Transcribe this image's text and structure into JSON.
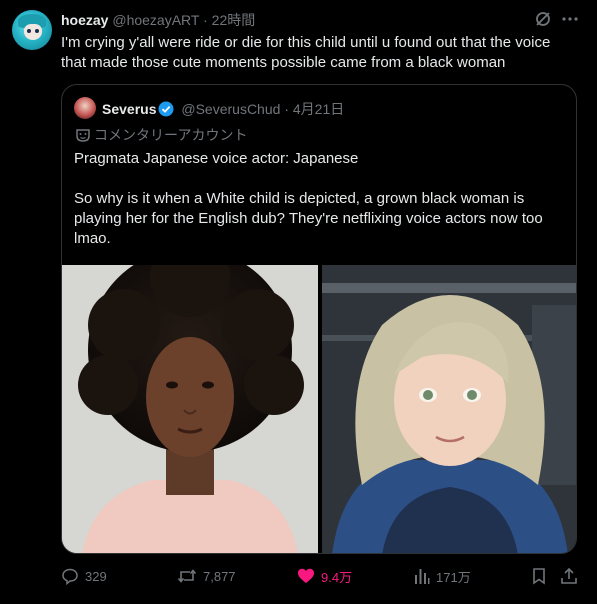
{
  "post": {
    "author_name": "hoezay",
    "author_handle": "@hoezayART",
    "separator": "·",
    "time": "22時間",
    "text": "I'm crying y'all were ride or die for this child until u found out that the voice that made those cute moments possible came from a black woman"
  },
  "quote": {
    "author_name": "Severus",
    "author_handle": "@SeverusChud",
    "separator": "·",
    "date": "4月21日",
    "account_label": "コメンタリーアカウント",
    "paragraph1": "Pragmata Japanese voice actor: Japanese",
    "paragraph2": "So why is it when a White child is depicted, a grown black woman is playing her for the English dub? They're netflixing voice actors now too lmao.",
    "images": [
      "photo of a woman with curly hair",
      "3D render of a blonde child character"
    ]
  },
  "actions": {
    "replies": "329",
    "reposts": "7,877",
    "likes": "9.4万",
    "views": "171万"
  },
  "colors": {
    "background": "#000000",
    "text": "#e7e9ea",
    "muted": "#71767b",
    "like": "#f91880",
    "verified": "#1d9bf0",
    "border": "#2f3336"
  },
  "icons": [
    "grok-icon",
    "more-icon",
    "verified-icon",
    "commentary-mask-icon",
    "reply-icon",
    "repost-icon",
    "like-icon",
    "views-icon",
    "bookmark-icon",
    "share-icon"
  ]
}
